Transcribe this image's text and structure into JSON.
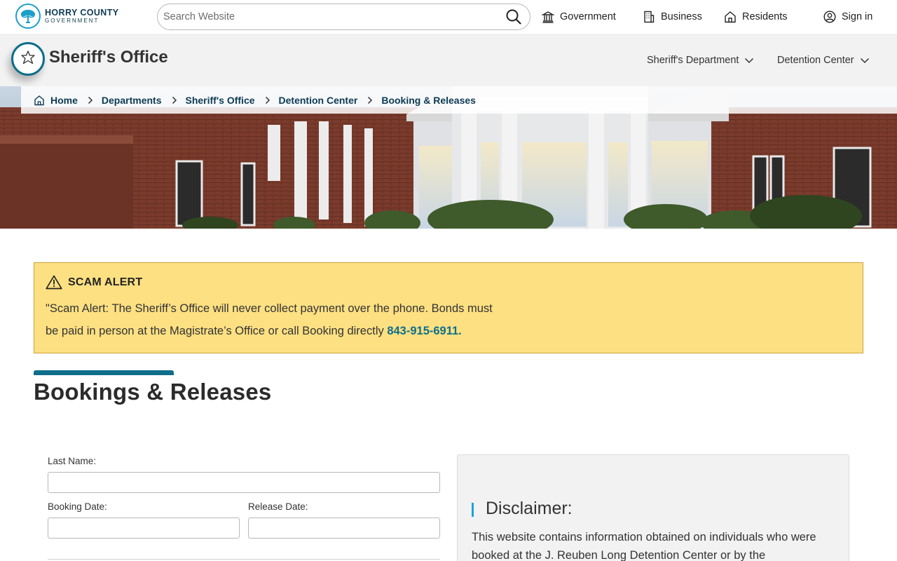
{
  "header": {
    "logo_line1": "HORRY COUNTY",
    "logo_line2": "GOVERNMENT",
    "search_placeholder": "Search Website",
    "nav": {
      "government": "Government",
      "business": "Business",
      "residents": "Residents",
      "sign_in": "Sign in"
    }
  },
  "section": {
    "title": "Sheriff's Office",
    "nav": {
      "sheriffs_department": "Sheriff's Department",
      "detention_center": "Detention Center"
    }
  },
  "breadcrumb": [
    "Home",
    "Departments",
    "Sheriff's Office",
    "Detention Center",
    "Booking & Releases"
  ],
  "alert": {
    "title": "SCAM ALERT",
    "line1": "\"Scam Alert: The Sheriff’s Office will never collect payment over the phone. Bonds must",
    "line2": "be paid in person at the Magistrate’s Office or call Booking directly ",
    "phone": "843-915-6911."
  },
  "page": {
    "title": "Bookings & Releases"
  },
  "form": {
    "last_name_label": "Last Name:",
    "booking_date_label": "Booking Date:",
    "release_date_label": "Release Date:"
  },
  "disclaimer": {
    "title": "Disclaimer:",
    "text": "This website contains information obtained on individuals who were booked at the J. Reuben Long Detention Center or by the"
  },
  "colors": {
    "accent_teal": "#0e6e8a",
    "alert_yellow": "#fde082",
    "nav_dark": "#0d3b53",
    "disclaimer_bar": "#1aa3d9"
  }
}
